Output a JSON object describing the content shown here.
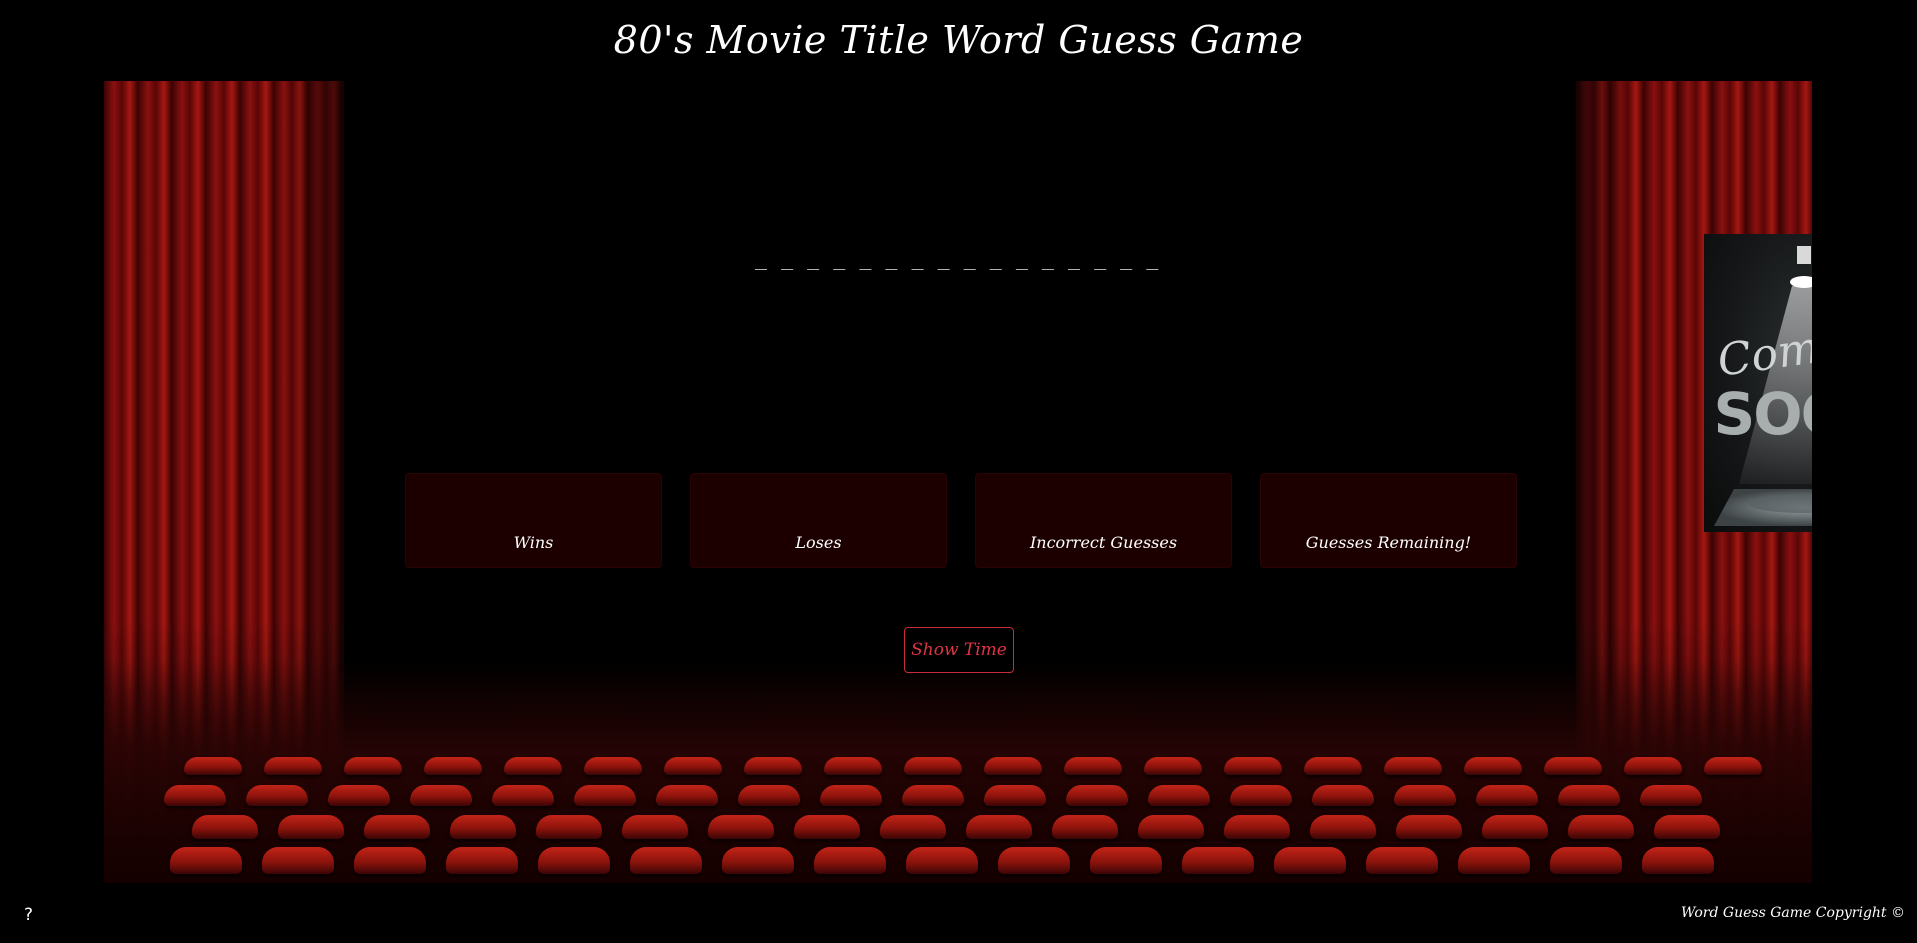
{
  "header": {
    "title": "80's Movie Title Word Guess Game"
  },
  "game": {
    "word_display": "_ _ _ _ _ _ _ _ _ _ _ _ _ _ _ _ _ _ _ _ _ _ _ _ _ _ _ _ _ _ _ _ _ _ _ _ _ _ _"
  },
  "stats": [
    {
      "label": "Wins",
      "value": ""
    },
    {
      "label": "Loses",
      "value": ""
    },
    {
      "label": "Incorrect Guesses",
      "value": ""
    },
    {
      "label": "Guesses Remaining!",
      "value": ""
    }
  ],
  "actions": {
    "start_label": "Show Time"
  },
  "poster": {
    "line1": "Coming",
    "line2": "SOON"
  },
  "footer": {
    "help": "?",
    "copyright": "Word Guess Game Copyright ©"
  },
  "colors": {
    "accent": "#dc3545",
    "card_bg": "#1c0000",
    "curtain": "#8a1010",
    "background": "#000000"
  }
}
